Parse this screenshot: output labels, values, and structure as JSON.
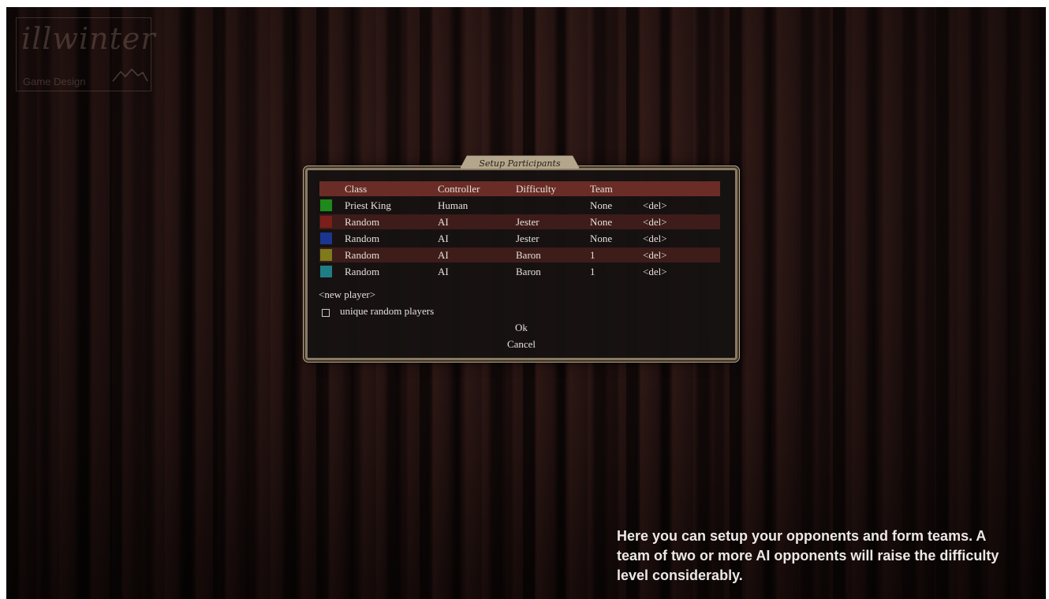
{
  "logo": {
    "title": "illwinter",
    "subtitle": "Game Design"
  },
  "dialog": {
    "title": "Setup Participants",
    "headers": {
      "class": "Class",
      "controller": "Controller",
      "difficulty": "Difficulty",
      "team": "Team"
    },
    "players": [
      {
        "color": "#1f8a1c",
        "class": "Priest King",
        "controller": "Human",
        "difficulty": "",
        "team": "None",
        "del": "<del>"
      },
      {
        "color": "#7a1f1b",
        "class": "Random",
        "controller": "AI",
        "difficulty": "Jester",
        "team": "None",
        "del": "<del>"
      },
      {
        "color": "#1c3590",
        "class": "Random",
        "controller": "AI",
        "difficulty": "Jester",
        "team": "None",
        "del": "<del>"
      },
      {
        "color": "#7f7a1c",
        "class": "Random",
        "controller": "AI",
        "difficulty": "Baron",
        "team": "1",
        "del": "<del>"
      },
      {
        "color": "#1f7d86",
        "class": "Random",
        "controller": "AI",
        "difficulty": "Baron",
        "team": "1",
        "del": "<del>"
      }
    ],
    "new_player": "<new player>",
    "unique_random": {
      "label": "unique random players",
      "checked": false
    },
    "ok": "Ok",
    "cancel": "Cancel"
  },
  "hint": "Here you can setup your opponents and form teams. A team of two or more AI opponents will raise the difficulty level considerably."
}
